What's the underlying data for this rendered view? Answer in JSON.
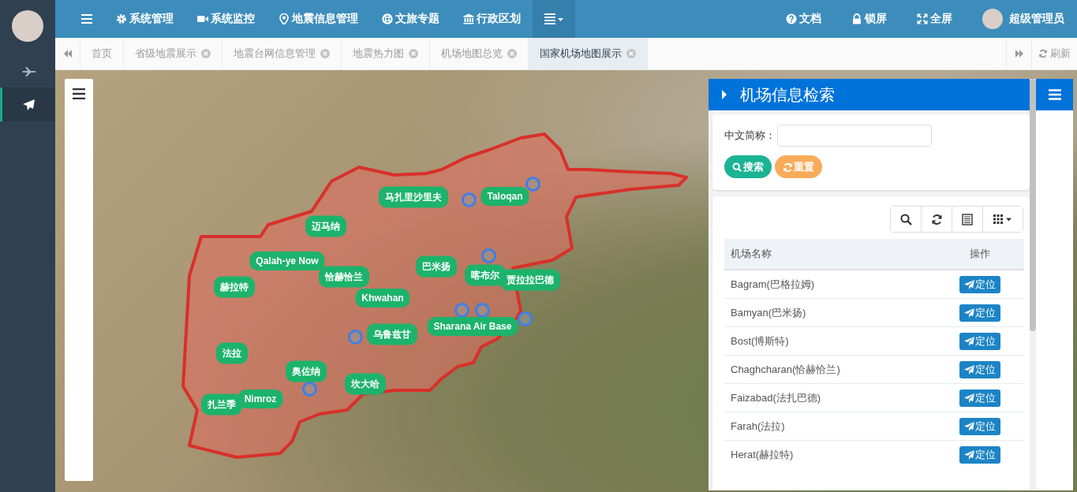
{
  "sidebar": {
    "items": [
      {
        "kind": "jet",
        "selected": false
      },
      {
        "kind": "plane",
        "selected": true
      }
    ]
  },
  "navbar": {
    "menu": [
      {
        "kind": "settings",
        "label": "系统管理"
      },
      {
        "kind": "monitor",
        "label": "系统监控"
      },
      {
        "kind": "marker",
        "label": "地震信息管理"
      },
      {
        "kind": "lifering",
        "label": "文旅专题"
      },
      {
        "kind": "bank",
        "label": "行政区划"
      }
    ],
    "more": {
      "selected": true
    },
    "tools": [
      {
        "kind": "help",
        "label": "文档"
      },
      {
        "kind": "lock",
        "label": "锁屏"
      },
      {
        "kind": "fullscreen",
        "label": "全屏"
      }
    ],
    "user": {
      "name": "超级管理员"
    }
  },
  "tabs": [
    {
      "label": "首页",
      "closable": false,
      "selected": false
    },
    {
      "label": "省级地震展示",
      "closable": true,
      "selected": false
    },
    {
      "label": "地震台网信息管理",
      "closable": true,
      "selected": false
    },
    {
      "label": "地震热力图",
      "closable": true,
      "selected": false
    },
    {
      "label": "机场地图总览",
      "closable": true,
      "selected": false
    },
    {
      "label": "国家机场地图展示",
      "closable": true,
      "selected": true
    }
  ],
  "tab_tools": {
    "refresh": "刷新"
  },
  "map": {
    "markers": [
      {
        "label": "马扎里沙里夫"
      },
      {
        "label": "Taloqan"
      },
      {
        "label": "迈马纳"
      },
      {
        "label": "Qalah-ye Now"
      },
      {
        "label": "恰赫恰兰"
      },
      {
        "label": "赫拉特"
      },
      {
        "label": "巴米扬"
      },
      {
        "label": "喀布尔"
      },
      {
        "label": "贾拉拉巴德"
      },
      {
        "label": "Khwahan"
      },
      {
        "label": "Sharana Air Base"
      },
      {
        "label": "乌鲁兹甘"
      },
      {
        "label": "法拉"
      },
      {
        "label": "奥佐纳"
      },
      {
        "label": "坎大哈"
      },
      {
        "label": "扎兰季"
      },
      {
        "label": "Nimroz"
      }
    ]
  },
  "panel": {
    "title": "机场信息检索",
    "search": {
      "label": "中文简称："
    },
    "buttons": [
      {
        "kind": "search",
        "label": "搜索"
      },
      {
        "kind": "reset",
        "label": "重置"
      }
    ],
    "table": {
      "columns": [
        "机场名称",
        "操作"
      ],
      "rows": [
        {
          "name": "Bagram(巴格拉姆)",
          "action": "定位"
        },
        {
          "name": "Bamyan(巴米扬)",
          "action": "定位"
        },
        {
          "name": "Bost(博斯特)",
          "action": "定位"
        },
        {
          "name": "Chaghcharan(恰赫恰兰)",
          "action": "定位"
        },
        {
          "name": "Faizabad(法扎巴德)",
          "action": "定位"
        },
        {
          "name": "Farah(法拉)",
          "action": "定位"
        },
        {
          "name": "Herat(赫拉特)",
          "action": "定位"
        }
      ]
    }
  }
}
